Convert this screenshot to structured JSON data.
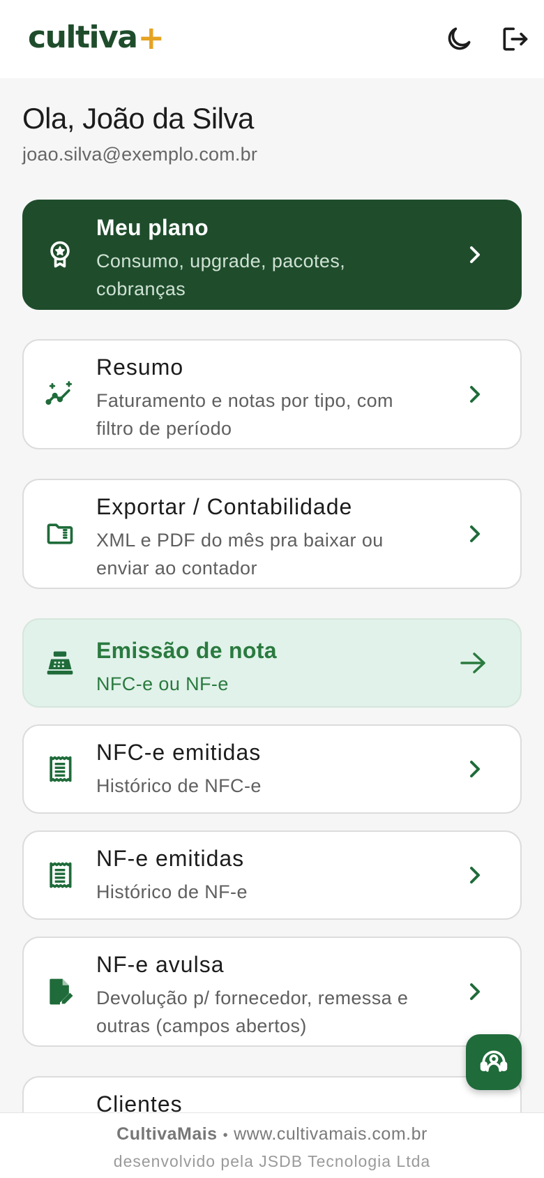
{
  "header": {
    "logo_text": "cultiva",
    "logo_plus": "+",
    "theme_icon": "moon-icon",
    "logout_icon": "logout-icon"
  },
  "user": {
    "greeting": "Ola, João da Silva",
    "email": "joao.silva@exemplo.com.br"
  },
  "menu": [
    {
      "icon": "award-icon",
      "title": "Meu plano",
      "subtitle": "Consumo, upgrade, pacotes, cobranças"
    },
    {
      "icon": "sparkline-icon",
      "title": "Resumo",
      "subtitle": "Faturamento e notas por tipo, com filtro de período"
    },
    {
      "icon": "folder-zip-icon",
      "title": "Exportar / Contabilidade",
      "subtitle": "XML e PDF do mês pra baixar ou enviar ao contador"
    },
    {
      "icon": "cash-register-icon",
      "title": "Emissão de nota",
      "subtitle": "NFC-e ou NF-e"
    },
    {
      "icon": "receipt-icon",
      "title": "NFC-e emitidas",
      "subtitle": "Histórico de NFC-e"
    },
    {
      "icon": "receipt-icon",
      "title": "NF-e emitidas",
      "subtitle": "Histórico de NF-e"
    },
    {
      "icon": "file-edit-icon",
      "title": "NF-e avulsa",
      "subtitle": "Devolução p/ fornecedor, remessa e outras (campos abertos)"
    },
    {
      "icon": "users-icon",
      "title": "Clientes",
      "subtitle": ""
    }
  ],
  "support": {
    "icon": "support-agent-icon"
  },
  "footer": {
    "brand": "CultivaMais",
    "separator": "•",
    "site": "www.cultivamais.com.br",
    "credit": "desenvolvido pela JSDB Tecnologia Ltda"
  },
  "colors": {
    "brand_green": "#1f4d2c",
    "accent_yellow": "#e5a323",
    "emit_bg": "#e1f2ea",
    "emit_text": "#2a7a3f"
  }
}
